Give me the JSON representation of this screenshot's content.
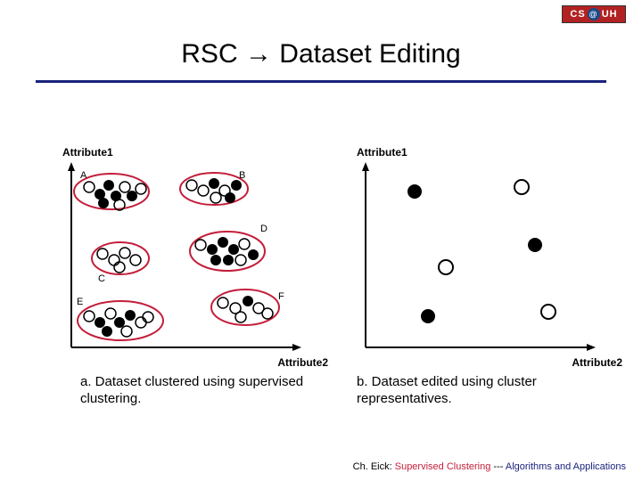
{
  "logo": {
    "left": "CS",
    "mid": "@",
    "right": "UH"
  },
  "title": "RSC → Dataset Editing",
  "left_plot": {
    "ylabel": "Attribute1",
    "xlabel": "Attribute2",
    "clusters": [
      "A",
      "B",
      "C",
      "D",
      "E",
      "F"
    ]
  },
  "right_plot": {
    "ylabel": "Attribute1",
    "xlabel": "Attribute2"
  },
  "captions": {
    "left": "a. Dataset clustered using supervised clustering.",
    "right": "b. Dataset edited using cluster representatives."
  },
  "footer": {
    "author": "Ch. Eick:",
    "topic": "Supervised Clustering",
    "sep": " --- ",
    "rest": "Algorithms and Applications"
  },
  "chart_data": [
    {
      "type": "scatter",
      "title": "a. Dataset clustered using supervised clustering.",
      "xlabel": "Attribute2",
      "ylabel": "Attribute1",
      "clusters": [
        {
          "name": "A",
          "members": 9,
          "filled": 5,
          "open": 4,
          "centroid": [
            0.18,
            0.87
          ]
        },
        {
          "name": "B",
          "members": 7,
          "filled": 3,
          "open": 4,
          "centroid": [
            0.62,
            0.88
          ]
        },
        {
          "name": "C",
          "members": 5,
          "filled": 0,
          "open": 5,
          "centroid": [
            0.22,
            0.53
          ]
        },
        {
          "name": "D",
          "members": 9,
          "filled": 6,
          "open": 3,
          "centroid": [
            0.7,
            0.55
          ]
        },
        {
          "name": "E",
          "members": 9,
          "filled": 4,
          "open": 5,
          "centroid": [
            0.22,
            0.17
          ]
        },
        {
          "name": "F",
          "members": 6,
          "filled": 1,
          "open": 5,
          "centroid": [
            0.78,
            0.23
          ]
        }
      ]
    },
    {
      "type": "scatter",
      "title": "b. Dataset edited using cluster representatives.",
      "xlabel": "Attribute2",
      "ylabel": "Attribute1",
      "points": [
        {
          "x": 0.22,
          "y": 0.88,
          "class": "filled"
        },
        {
          "x": 0.7,
          "y": 0.9,
          "class": "open"
        },
        {
          "x": 0.78,
          "y": 0.58,
          "class": "filled"
        },
        {
          "x": 0.35,
          "y": 0.45,
          "class": "open"
        },
        {
          "x": 0.28,
          "y": 0.18,
          "class": "filled"
        },
        {
          "x": 0.82,
          "y": 0.2,
          "class": "open"
        }
      ]
    }
  ]
}
